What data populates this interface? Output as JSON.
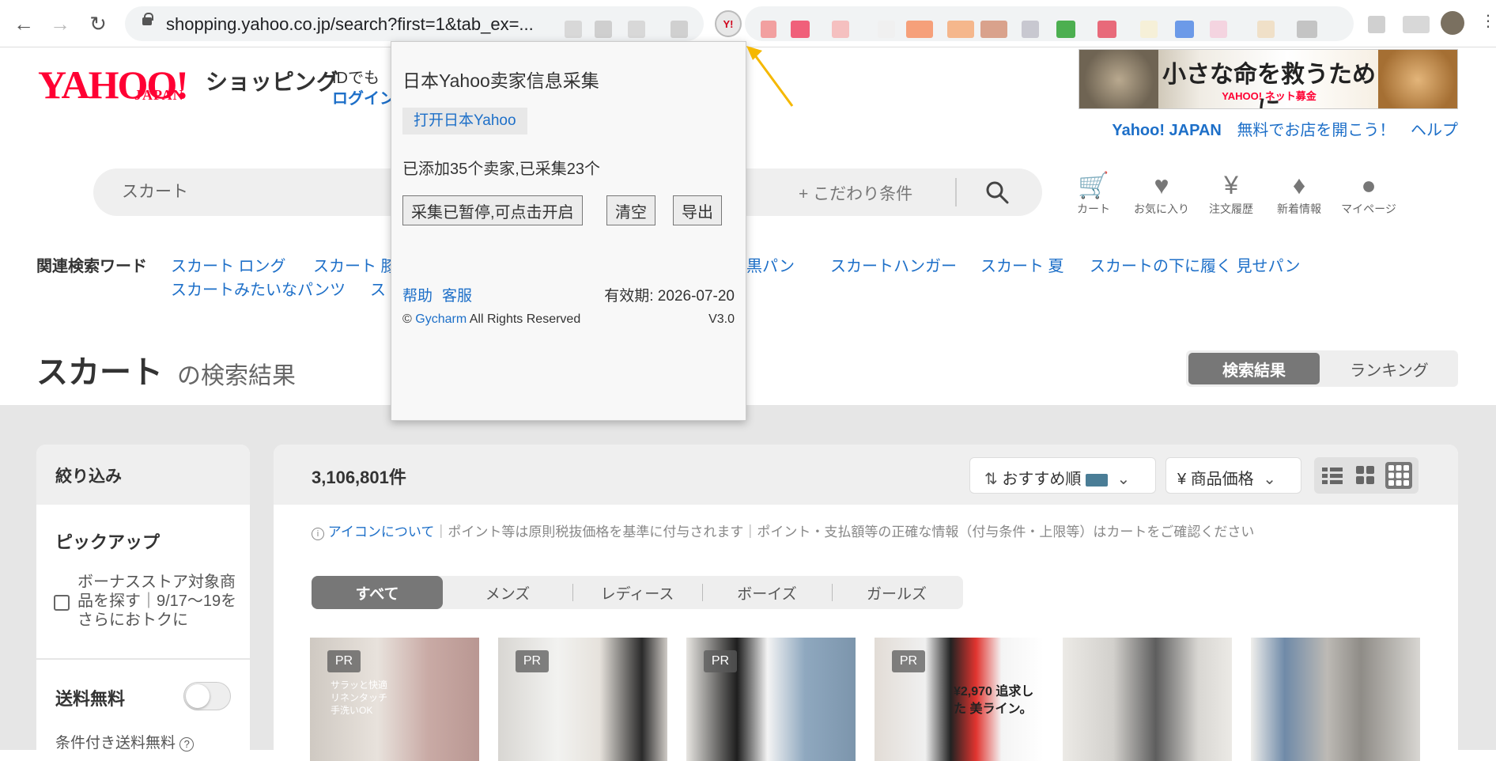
{
  "browser": {
    "url": "shopping.yahoo.co.jp/search?first=1&tab_ex=...",
    "ext_icon_label": "Y!"
  },
  "header": {
    "logo": "YAHOO!",
    "logo_sub": "JAPAN",
    "shopping": "ショッピング",
    "id_prompt": "IDでも",
    "login": "ログイン",
    "banner_text": "小さな命を救うために",
    "banner_sub": "YAHOO! ネット募金",
    "links": [
      "Yahoo! JAPAN",
      "無料でお店を開こう！",
      "ヘルプ"
    ]
  },
  "search": {
    "placeholder": "スカート",
    "kodawari": "+ こだわり条件"
  },
  "header_icons": [
    {
      "label": "カート"
    },
    {
      "label": "お気に入り"
    },
    {
      "label": "注文履歴"
    },
    {
      "label": "新着情報"
    },
    {
      "label": "マイページ"
    }
  ],
  "related": {
    "label": "関連検索ワード",
    "words": [
      "スカート ロング",
      "スカート 膝",
      "黒パン",
      "スカートハンガー",
      "スカート 夏",
      "スカートの下に履く 見せパン",
      "スカートみたいなパンツ",
      "ス"
    ]
  },
  "results": {
    "query": "スカート",
    "suffix": "の検索結果",
    "tab_active": "検索結果",
    "tab_inactive": "ランキング",
    "count": "3,106,801件",
    "sort": "おすすめ順",
    "price": "商品価格",
    "notice_link": "アイコンについて",
    "notice_text": "｜ポイント等は原則税抜価格を基準に付与されます｜ポイント・支払額等の正確な情報（付与条件・上限等）はカートをご確認ください",
    "gender_tabs": [
      "すべて",
      "メンズ",
      "レディース",
      "ボーイズ",
      "ガールズ"
    ],
    "pr": "PR",
    "product_texts": [
      "サラッと快適 リネンタッチ 手洗いOK",
      "",
      "",
      "¥2,970 追求した 美ライン。",
      "",
      ""
    ]
  },
  "filter": {
    "title": "絞り込み",
    "pickup": "ピックアップ",
    "pickup_text": "ボーナスストア対象商品を探す｜9/17〜19をさらにおトクに",
    "free_ship": "送料無料",
    "cond_ship": "条件付き送料無料"
  },
  "popup": {
    "title": "日本Yahoo卖家信息采集",
    "open_button": "打开日本Yahoo",
    "status": "已添加35个卖家,已采集23个",
    "btn_pause": "采集已暂停,可点击开启",
    "btn_clear": "清空",
    "btn_export": "导出",
    "help": "帮助",
    "support": "客服",
    "expiry": "有效期: 2026-07-20",
    "copyright_prefix": "©",
    "brand": "Gycharm",
    "copyright_suffix": "All Rights Reserved",
    "version": "V3.0"
  },
  "colors": {
    "yahoo_red": "#ff0033",
    "link_blue": "#1d6fc8",
    "arrow": "#f5b800"
  }
}
